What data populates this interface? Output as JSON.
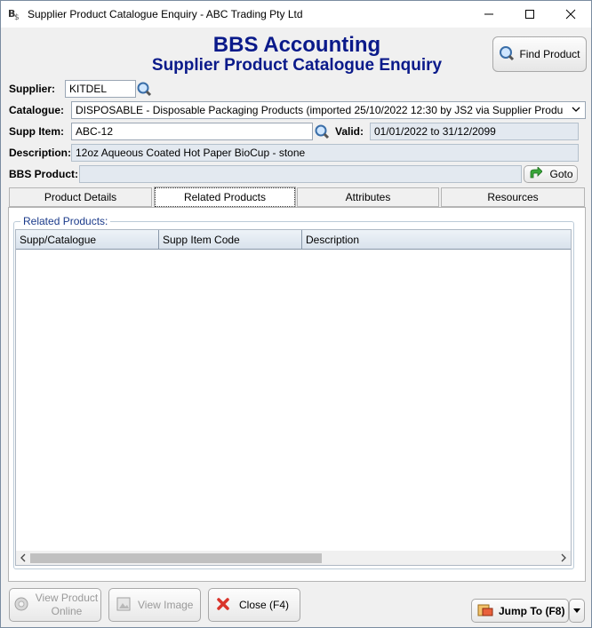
{
  "window": {
    "title": "Supplier Product Catalogue Enquiry - ABC Trading Pty Ltd"
  },
  "header": {
    "title": "BBS Accounting",
    "subtitle": "Supplier Product Catalogue Enquiry",
    "find_label": "Find Product"
  },
  "form": {
    "supplier_label": "Supplier:",
    "supplier_value": "KITDEL",
    "catalogue_label": "Catalogue:",
    "catalogue_value": "DISPOSABLE - Disposable Packaging Products (imported 25/10/2022 12:30 by JS2 via Supplier Produ",
    "supp_item_label": "Supp Item:",
    "supp_item_value": "ABC-12",
    "valid_label": "Valid:",
    "valid_value": "01/01/2022 to 31/12/2099",
    "description_label": "Description:",
    "description_value": "12oz Aqueous Coated Hot Paper BioCup - stone",
    "bbs_product_label": "BBS Product:",
    "bbs_product_value": "",
    "goto_label": "Goto"
  },
  "tabs": [
    {
      "label": "Product Details"
    },
    {
      "label": "Related Products"
    },
    {
      "label": "Attributes"
    },
    {
      "label": "Resources"
    }
  ],
  "related": {
    "group_label": "Related Products:",
    "columns": [
      "Supp/Catalogue",
      "Supp Item Code",
      "Description"
    ]
  },
  "buttons": {
    "view_online_line1": "View Product",
    "view_online_line2": "Online",
    "view_image": "View Image",
    "close": "Close (F4)",
    "jump_to": "Jump To (F8)"
  },
  "colors": {
    "heading": "#0a1a8a",
    "readonly_bg": "#e3e9f0"
  }
}
